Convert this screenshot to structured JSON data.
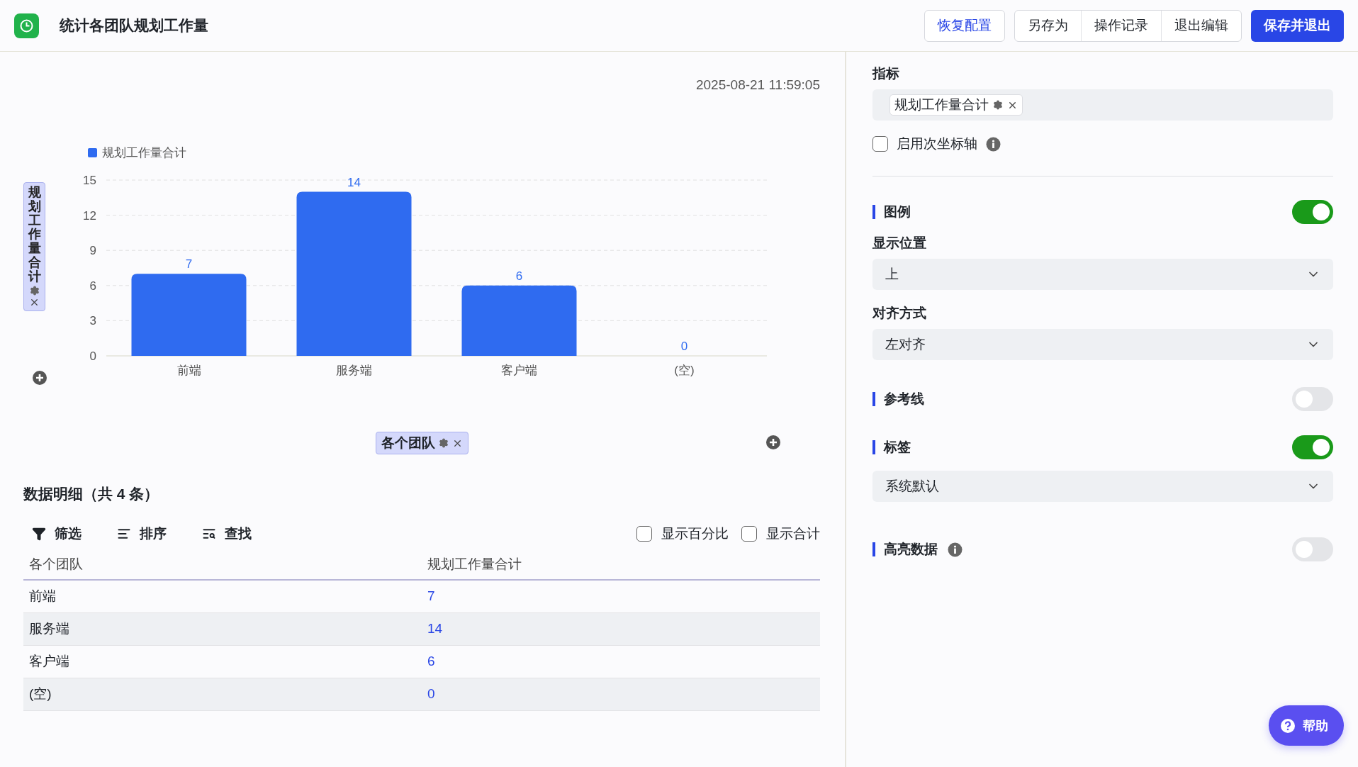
{
  "header": {
    "title": "统计各团队规划工作量",
    "buttons": [
      {
        "label": "恢复配置",
        "kind": "outline"
      },
      {
        "label": "另存为",
        "kind": "group"
      },
      {
        "label": "操作记录",
        "kind": "group"
      },
      {
        "label": "退出编辑",
        "kind": "group"
      },
      {
        "label": "保存并退出",
        "kind": "primary"
      }
    ]
  },
  "chart_panel": {
    "timestamp": "2025-08-21 11:59:05",
    "y_axis_field": {
      "label": "规划工作量合计"
    },
    "x_axis_field": {
      "label": "各个团队"
    },
    "chart_data": {
      "type": "bar",
      "categories": [
        "前端",
        "服务端",
        "客户端",
        "(空)"
      ],
      "series": [
        {
          "name": "规划工作量合计",
          "color": "#2f6bf0",
          "values": [
            7,
            14,
            6,
            0
          ]
        }
      ],
      "ylim": [
        0,
        15
      ],
      "grid": true,
      "yticks": [
        0,
        3,
        6,
        9,
        12,
        15
      ],
      "data_labels": true
    }
  },
  "details": {
    "title": "数据明细（共 4 条）",
    "tools": [
      {
        "label": "筛选"
      },
      {
        "label": "排序"
      },
      {
        "label": "查找"
      }
    ],
    "options": [
      {
        "label": "显示百分比",
        "checked": false
      },
      {
        "label": "显示合计",
        "checked": false
      }
    ],
    "table": {
      "columns": [
        "各个团队",
        "规划工作量合计"
      ],
      "rows": [
        [
          "前端",
          "7"
        ],
        [
          "服务端",
          "14"
        ],
        [
          "客户端",
          "6"
        ],
        [
          "(空)",
          "0"
        ]
      ]
    }
  },
  "settings": {
    "metric": {
      "label": "指标",
      "tag": "规划工作量合计"
    },
    "secondary_axis": {
      "label": "启用次坐标轴",
      "checked": false
    },
    "items": [
      {
        "kind": "toggle",
        "title": "图例",
        "on": true,
        "info": false
      },
      {
        "kind": "select",
        "label": "显示位置",
        "value": "上"
      },
      {
        "kind": "select",
        "label": "对齐方式",
        "value": "左对齐"
      },
      {
        "kind": "toggle",
        "title": "参考线",
        "on": false,
        "info": false
      },
      {
        "kind": "toggle",
        "title": "标签",
        "on": true,
        "info": false
      },
      {
        "kind": "select",
        "value": "系统默认"
      },
      {
        "kind": "toggle",
        "title": "高亮数据",
        "on": false,
        "info": true
      }
    ]
  },
  "help_button": {
    "label": "帮助"
  }
}
